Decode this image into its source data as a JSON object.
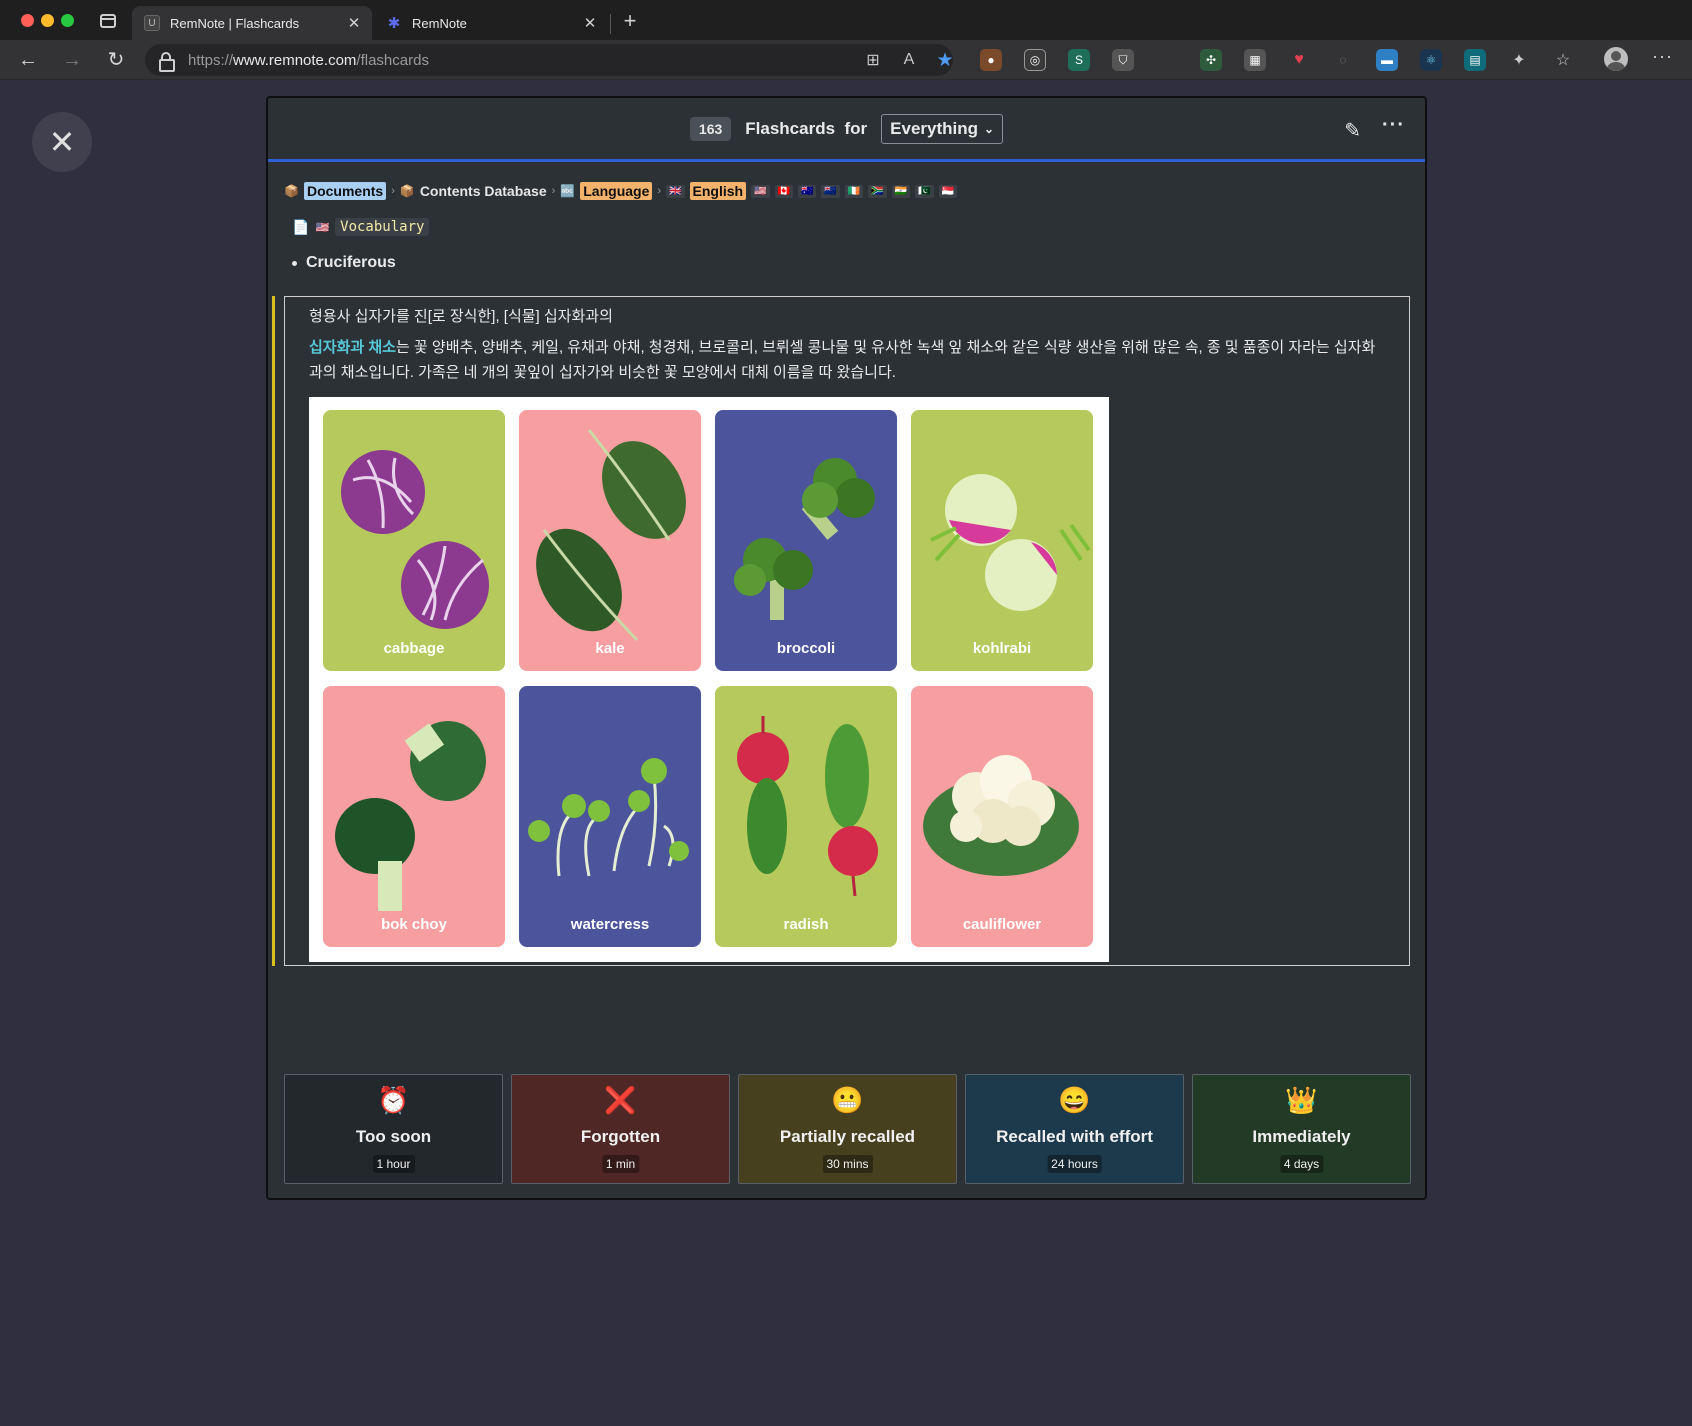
{
  "browser": {
    "tabs": [
      {
        "title": "RemNote | Flashcards",
        "favicon": "U",
        "active": true
      },
      {
        "title": "RemNote",
        "favicon": "remnote-paw-icon",
        "active": false
      }
    ],
    "url_prefix": "https://",
    "url_host": "www.remnote.com",
    "url_path": "/flashcards"
  },
  "header": {
    "count": "163",
    "label_flashcards": "Flashcards",
    "label_for": "for",
    "scope": "Everything"
  },
  "breadcrumb": {
    "documents": "Documents",
    "contents_database": "Contents Database",
    "language": "Language",
    "english": "English",
    "flags": [
      "🇺🇸",
      "🇨🇦",
      "🇦🇺",
      "🇳🇿",
      "🇮🇪",
      "🇿🇦",
      "🇮🇳",
      "🇵🇰",
      "🇸🇬"
    ]
  },
  "document": {
    "flag": "🇺🇸",
    "name": "Vocabulary"
  },
  "card": {
    "front": "Cruciferous",
    "part_of_speech": "형용사  십자가를 진[로 장식한], [식물] 십자화과의",
    "definition_highlight": "십자화과 채소",
    "definition_rest": "는 꽃 양배추,  양배추, 케일, 유채과 야채, 청경채, 브로콜리, 브뤼셀 콩나물 및 유사한 녹색 잎 채소와 같은 식량 생산을 위해 많은 속, 종 및  품종이 자라는 십자화과의 채소입니다. 가족은 네 개의 꽃잎이 십자가와 비슷한 꽃 모양에서 대체 이름을 따 왔습니다."
  },
  "vegetables": [
    {
      "name": "cabbage",
      "bg": "#b5c95c"
    },
    {
      "name": "kale",
      "bg": "#f79ea0"
    },
    {
      "name": "broccoli",
      "bg": "#4c559c"
    },
    {
      "name": "kohlrabi",
      "bg": "#b5c95c"
    },
    {
      "name": "bok choy",
      "bg": "#f79ea0"
    },
    {
      "name": "watercress",
      "bg": "#4c559c"
    },
    {
      "name": "radish",
      "bg": "#b5c95c"
    },
    {
      "name": "cauliflower",
      "bg": "#f79ea0"
    }
  ],
  "grades": [
    {
      "label": "Too soon",
      "time": "1 hour",
      "icon": "⏰",
      "bg": "#23282d"
    },
    {
      "label": "Forgotten",
      "time": "1 min",
      "icon": "❌",
      "bg": "#4f2825"
    },
    {
      "label": "Partially recalled",
      "time": "30 mins",
      "icon": "😬",
      "bg": "#46401f"
    },
    {
      "label": "Recalled with effort",
      "time": "24 hours",
      "icon": "😄",
      "bg": "#1d394c"
    },
    {
      "label": "Immediately",
      "time": "4 days",
      "icon": "👑",
      "bg": "#223a26"
    }
  ],
  "colors": {
    "accent_blue": "#2e5fd4",
    "answer_bar": "#d8c11e",
    "highlight": "#56c8d8"
  }
}
